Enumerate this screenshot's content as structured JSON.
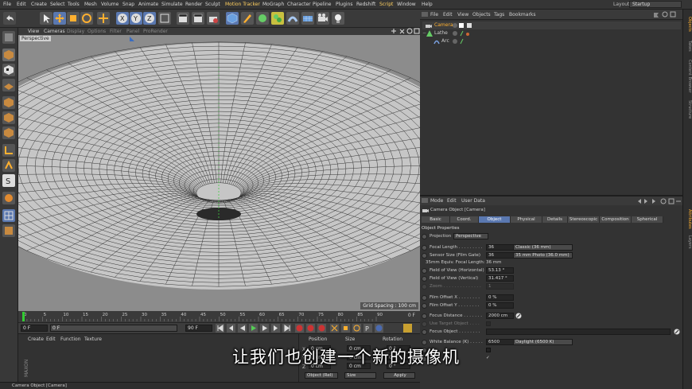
{
  "menubar": {
    "items": [
      "File",
      "Edit",
      "Create",
      "Select",
      "Tools",
      "Mesh",
      "Volume",
      "Snap",
      "Animate",
      "Simulate",
      "Render",
      "Sculpt",
      "Motion Tracker",
      "MoGraph",
      "Character",
      "Pipeline",
      "Plugins",
      "Redshift",
      "Script",
      "Window",
      "Help"
    ],
    "layout_label": "Layout:",
    "layout_value": "Startup"
  },
  "viewport": {
    "menu": [
      "View",
      "Cameras",
      "Display",
      "Options",
      "Filter",
      "Panel",
      "ProRender"
    ],
    "label": "Perspective",
    "grid_spacing": "Grid Spacing : 100 cm"
  },
  "timeline": {
    "ticks": [
      "0",
      "5",
      "10",
      "15",
      "20",
      "25",
      "30",
      "35",
      "40",
      "45",
      "50",
      "55",
      "60",
      "65",
      "70",
      "75",
      "80",
      "85",
      "90"
    ],
    "end_label": "0 F"
  },
  "transport": {
    "start": "0 F",
    "current": "0 F",
    "end": "90 F",
    "max": "90 F"
  },
  "material": {
    "menu": [
      "Create",
      "Edit",
      "Function",
      "Texture"
    ]
  },
  "coords": {
    "headers": [
      "Position",
      "Size",
      "Rotation"
    ],
    "rows": [
      {
        "axis": "X",
        "pos": "0 cm",
        "size": "0 cm",
        "rot": "0 °"
      },
      {
        "axis": "Y",
        "pos": "0 cm",
        "size": "0 cm",
        "rot": "0 °"
      },
      {
        "axis": "Z",
        "pos": "0 cm",
        "size": "0 cm",
        "rot": "0 °"
      }
    ],
    "mode": "Object (Rel)",
    "size_mode": "Size",
    "apply": "Apply"
  },
  "statusbar": {
    "text": "Camera Object [Camera]"
  },
  "object_manager": {
    "menu": [
      "File",
      "Edit",
      "View",
      "Objects",
      "Tags",
      "Bookmarks"
    ],
    "objects": [
      {
        "name": "Camera",
        "indent": 0
      },
      {
        "name": "Lathe",
        "indent": 0
      },
      {
        "name": "Arc",
        "indent": 1
      }
    ]
  },
  "attr_manager": {
    "menu": [
      "Mode",
      "Edit",
      "User Data"
    ],
    "title": "Camera Object [Camera]",
    "tabs": [
      "Basic",
      "Coord.",
      "Object",
      "Physical",
      "Details",
      "Stereoscopic",
      "Composition",
      "Spherical"
    ],
    "active_tab": "Object",
    "section": "Object Properties",
    "props": [
      {
        "label": "Projection",
        "dd": "Perspective"
      },
      {
        "label": "Focal Length . . . . . . . . .",
        "value": "36",
        "dd": "Classic (36 mm)"
      },
      {
        "label": "Sensor Size (Film Gate)",
        "value": "36",
        "dd": "35 mm Photo (36.0 mm)"
      },
      {
        "label": "35mm Equiv. Focal Length:",
        "text": "36 mm"
      },
      {
        "label": "Field of View (Horizontal)",
        "value": "53.13 °"
      },
      {
        "label": "Field of View (Vertical)",
        "value": "31.417 °"
      },
      {
        "label": "Zoom . . . . . . . . . . . . . .",
        "value": "1"
      },
      {
        "label": "Film Offset X . . . . . . . .",
        "value": "0 %"
      },
      {
        "label": "Film Offset Y . . . . . . . .",
        "value": "0 %"
      },
      {
        "label": "Focus Distance . . . . . . .",
        "value": "2000 cm"
      },
      {
        "label": "Use Target Object . . . .",
        "value": ""
      },
      {
        "label": "Focus Object . . . . . . . .",
        "value": ""
      },
      {
        "label": "White Balance (K) . . . . .",
        "value": "6500",
        "dd": "Daylight (6500 K)"
      },
      {
        "label": "Affect Lights Only",
        "value": ""
      },
      {
        "label": "Export to Compositing",
        "value": ""
      }
    ]
  },
  "rightstrip": {
    "tabs": [
      "Objects",
      "Takes",
      "Content Browser",
      "Structure",
      "Attributes",
      "Layers"
    ]
  },
  "subtitle": "让我们也创建一个新的摄像机",
  "colors": {
    "accent": "#5a78b0",
    "viewport_bg": "#8c8c8c",
    "selected_obj": "#ffb030"
  }
}
